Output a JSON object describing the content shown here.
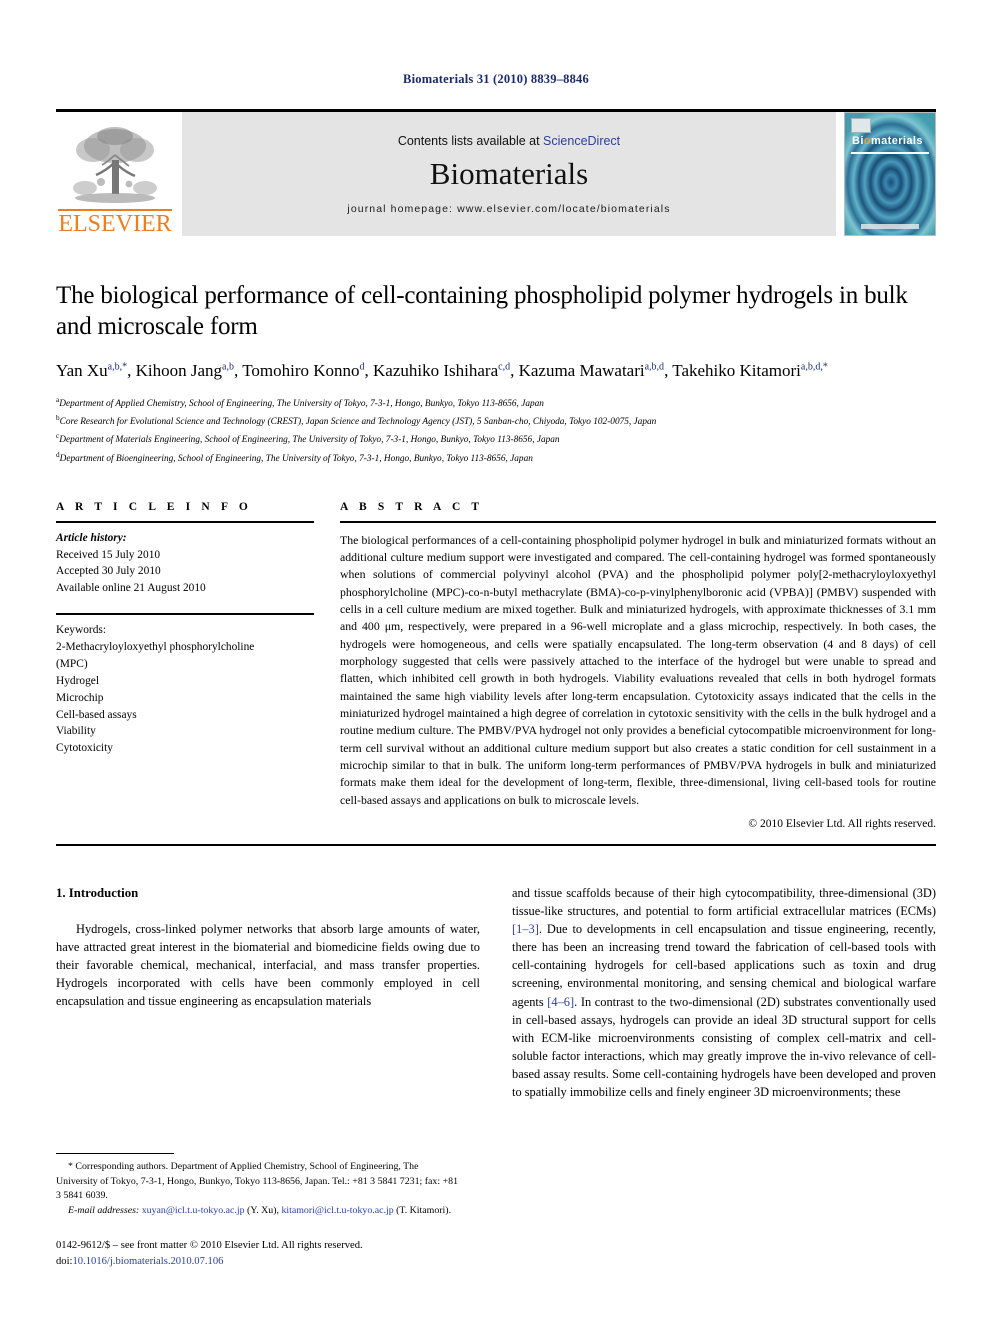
{
  "running_head": "Biomaterials 31 (2010) 8839–8846",
  "masthead": {
    "publisher_name": "ELSEVIER",
    "contents_prefix": "Contents lists available at ",
    "sciencedirect": "ScienceDirect",
    "journal_name": "Biomaterials",
    "homepage": "journal homepage: www.elsevier.com/locate/biomaterials",
    "cover": {
      "title_b": "B",
      "title_i": "i",
      "title_o": "o",
      "title_rest": "materials"
    }
  },
  "article": {
    "title": "The biological performance of cell-containing phospholipid polymer hydrogels in bulk and microscale form",
    "authors": [
      {
        "name": "Yan Xu",
        "sup": "a,b,*",
        "sep": ", "
      },
      {
        "name": "Kihoon Jang",
        "sup": "a,b",
        "sep": ", "
      },
      {
        "name": "Tomohiro Konno",
        "sup": "d",
        "sep": ", "
      },
      {
        "name": "Kazuhiko Ishihara",
        "sup": "c,d",
        "sep": ", "
      },
      {
        "name": "Kazuma Mawatari",
        "sup": "a,b,d",
        "sep": ", "
      },
      {
        "name": "Takehiko Kitamori",
        "sup": "a,b,d,*",
        "sep": ""
      }
    ],
    "affiliations": [
      {
        "mark": "a",
        "text": "Department of Applied Chemistry, School of Engineering, The University of Tokyo, 7-3-1, Hongo, Bunkyo, Tokyo 113-8656, Japan"
      },
      {
        "mark": "b",
        "text": "Core Research for Evolutional Science and Technology (CREST), Japan Science and Technology Agency (JST), 5 Sanban-cho, Chiyoda, Tokyo 102-0075, Japan"
      },
      {
        "mark": "c",
        "text": "Department of Materials Engineering, School of Engineering, The University of Tokyo, 7-3-1, Hongo, Bunkyo, Tokyo 113-8656, Japan"
      },
      {
        "mark": "d",
        "text": "Department of Bioengineering, School of Engineering, The University of Tokyo, 7-3-1, Hongo, Bunkyo, Tokyo 113-8656, Japan"
      }
    ]
  },
  "article_info": {
    "heading": "A R T I C L E   I N F O",
    "history_label": "Article history:",
    "received": "Received 15 July 2010",
    "accepted": "Accepted 30 July 2010",
    "available": "Available online 21 August 2010",
    "keywords_label": "Keywords:",
    "keywords": [
      "2-Methacryloyloxyethyl phosphorylcholine",
      "(MPC)",
      "Hydrogel",
      "Microchip",
      "Cell-based assays",
      "Viability",
      "Cytotoxicity"
    ]
  },
  "abstract": {
    "heading": "A B S T R A C T",
    "text": "The biological performances of a cell-containing phospholipid polymer hydrogel in bulk and miniaturized formats without an additional culture medium support were investigated and compared. The cell-containing hydrogel was formed spontaneously when solutions of commercial polyvinyl alcohol (PVA) and the phospholipid polymer poly[2-methacryloyloxyethyl phosphorylcholine (MPC)-co-n-butyl methacrylate (BMA)-co-p-vinylphenylboronic acid (VPBA)] (PMBV) suspended with cells in a cell culture medium are mixed together. Bulk and miniaturized hydrogels, with approximate thicknesses of 3.1 mm and 400 μm, respectively, were prepared in a 96-well microplate and a glass microchip, respectively. In both cases, the hydrogels were homogeneous, and cells were spatially encapsulated. The long-term observation (4 and 8 days) of cell morphology suggested that cells were passively attached to the interface of the hydrogel but were unable to spread and flatten, which inhibited cell growth in both hydrogels. Viability evaluations revealed that cells in both hydrogel formats maintained the same high viability levels after long-term encapsulation. Cytotoxicity assays indicated that the cells in the miniaturized hydrogel maintained a high degree of correlation in cytotoxic sensitivity with the cells in the bulk hydrogel and a routine medium culture. The PMBV/PVA hydrogel not only provides a beneficial cytocompatible microenvironment for long-term cell survival without an additional culture medium support but also creates a static condition for cell sustainment in a microchip similar to that in bulk. The uniform long-term performances of PMBV/PVA hydrogels in bulk and miniaturized formats make them ideal for the development of long-term, flexible, three-dimensional, living cell-based tools for routine cell-based assays and applications on bulk to microscale levels.",
    "copyright": "© 2010 Elsevier Ltd. All rights reserved."
  },
  "introduction": {
    "heading": "1. Introduction",
    "left_paragraph": "Hydrogels, cross-linked polymer networks that absorb large amounts of water, have attracted great interest in the biomaterial and biomedicine fields owing due to their favorable chemical, mechanical, interfacial, and mass transfer properties. Hydrogels incorporated with cells have been commonly employed in cell encapsulation and tissue engineering as encapsulation materials",
    "right_part1": "and tissue scaffolds because of their high cytocompatibility, three-dimensional (3D) tissue-like structures, and potential to form artificial extracellular matrices (ECMs) ",
    "right_ref1": "[1–3]",
    "right_part2": ". Due to developments in cell encapsulation and tissue engineering, recently, there has been an increasing trend toward the fabrication of cell-based tools with cell-containing hydrogels for cell-based applications such as toxin and drug screening, environmental monitoring, and sensing chemical and biological warfare agents ",
    "right_ref2": "[4–6]",
    "right_part3": ". In contrast to the two-dimensional (2D) substrates conventionally used in cell-based assays, hydrogels can provide an ideal 3D structural support for cells with ECM-like microenvironments consisting of complex cell-matrix and cell-soluble factor interactions, which may greatly improve the in-vivo relevance of cell-based assay results. Some cell-containing hydrogels have been developed and proven to spatially immobilize cells and finely engineer 3D microenvironments; these"
  },
  "footnotes": {
    "corresponding": "* Corresponding authors. Department of Applied Chemistry, School of Engineering, The University of Tokyo, 7-3-1, Hongo, Bunkyo, Tokyo 113-8656, Japan. Tel.: +81 3 5841 7231; fax: +81 3 5841 6039.",
    "email_label": "E-mail addresses:",
    "email1": "xuyan@icl.t.u-tokyo.ac.jp",
    "email1_owner": " (Y. Xu), ",
    "email2": "kitamori@icl.t.u-tokyo.ac.jp",
    "email2_owner": " (T. Kitamori).",
    "issn_line": "0142-9612/$ – see front matter © 2010 Elsevier Ltd. All rights reserved.",
    "doi_label": "doi:",
    "doi_value": "10.1016/j.biomaterials.2010.07.106"
  },
  "colors": {
    "link_blue": "#2b3f9e",
    "elsevier_orange": "#ef7d1a",
    "running_head_blue": "#1a2a6c",
    "band_gray": "#e4e4e4"
  }
}
